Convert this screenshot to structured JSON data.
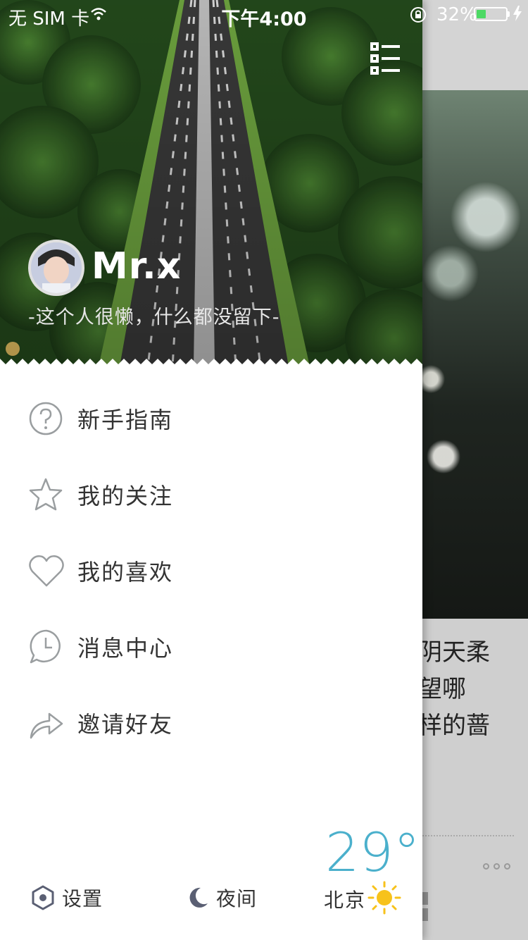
{
  "status_bar": {
    "carrier": "无 SIM 卡",
    "time": "下午4:00",
    "battery_percent": "32%",
    "battery_level": 0.32,
    "icons": [
      "wifi-icon",
      "orientation-lock-icon",
      "battery-icon",
      "charging-bolt-icon"
    ]
  },
  "profile": {
    "username": "Mr.x",
    "bio": "-这个人很懒，什么都没留下-"
  },
  "menu": {
    "items": [
      {
        "label": "新手指南",
        "icon": "question-circle-icon"
      },
      {
        "label": "我的关注",
        "icon": "star-icon"
      },
      {
        "label": "我的喜欢",
        "icon": "heart-icon"
      },
      {
        "label": "消息中心",
        "icon": "clock-bubble-icon"
      },
      {
        "label": "邀请好友",
        "icon": "share-arrow-icon"
      }
    ]
  },
  "footer": {
    "settings_label": "设置",
    "night_label": "夜间",
    "weather": {
      "temperature": "29°",
      "city": "北京",
      "icon": "sun-icon"
    }
  },
  "background_app": {
    "text_lines": [
      "朗阴天柔",
      "希望哪",
      "这样的蔷"
    ]
  },
  "colors": {
    "accent_temperature": "#4bb0cc",
    "icon_gray": "#9a9ea0",
    "sun": "#f7c21b",
    "battery_fill": "#4cd964"
  }
}
